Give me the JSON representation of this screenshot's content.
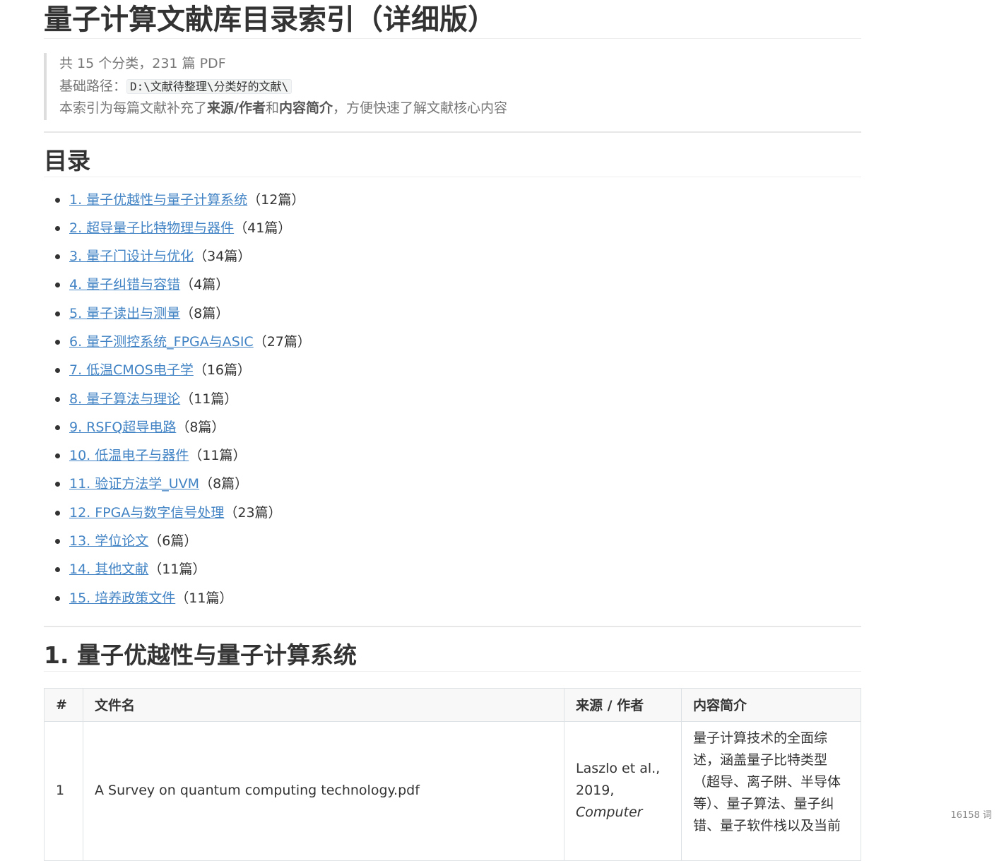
{
  "title": "量子计算文献库目录索引（详细版）",
  "summary": {
    "line1": "共 15 个分类，231 篇 PDF",
    "path_label": "基础路径：",
    "path_value": "D:\\文献待整理\\分类好的文献\\",
    "line3_prefix": "本索引为每篇文献补充了",
    "line3_bold1": "来源/作者",
    "line3_mid": "和",
    "line3_bold2": "内容简介",
    "line3_suffix": "，方便快速了解文献核心内容"
  },
  "toc": {
    "heading": "目录",
    "items": [
      {
        "label": "1. 量子优越性与量子计算系统",
        "count": "（12篇）"
      },
      {
        "label": "2. 超导量子比特物理与器件",
        "count": "（41篇）"
      },
      {
        "label": "3. 量子门设计与优化",
        "count": "（34篇）"
      },
      {
        "label": "4. 量子纠错与容错",
        "count": "（4篇）"
      },
      {
        "label": "5. 量子读出与测量",
        "count": "（8篇）"
      },
      {
        "label": "6. 量子测控系统_FPGA与ASIC",
        "count": "（27篇）"
      },
      {
        "label": "7. 低温CMOS电子学",
        "count": "（16篇）"
      },
      {
        "label": "8. 量子算法与理论",
        "count": "（11篇）"
      },
      {
        "label": "9. RSFQ超导电路",
        "count": "（8篇）"
      },
      {
        "label": "10. 低温电子与器件",
        "count": "（11篇）"
      },
      {
        "label": "11. 验证方法学_UVM",
        "count": "（8篇）"
      },
      {
        "label": "12. FPGA与数字信号处理",
        "count": "（23篇）"
      },
      {
        "label": "13. 学位论文",
        "count": "（6篇）"
      },
      {
        "label": "14. 其他文献",
        "count": "（11篇）"
      },
      {
        "label": "15. 培养政策文件",
        "count": "（11篇）"
      }
    ]
  },
  "section1": {
    "heading": "1. 量子优越性与量子计算系统",
    "columns": [
      "#",
      "文件名",
      "来源 / 作者",
      "内容简介"
    ],
    "rows": [
      {
        "num": "1",
        "file": "A Survey on quantum computing technology.pdf",
        "source_plain": "Laszlo et al., 2019,",
        "source_italic": "Computer",
        "summary": "量子计算技术的全面综述，涵盖量子比特类型（超导、离子阱、半导体等）、量子算法、量子纠错、量子软件栈以及当前"
      }
    ]
  },
  "status": {
    "word_count": "16158 词"
  }
}
